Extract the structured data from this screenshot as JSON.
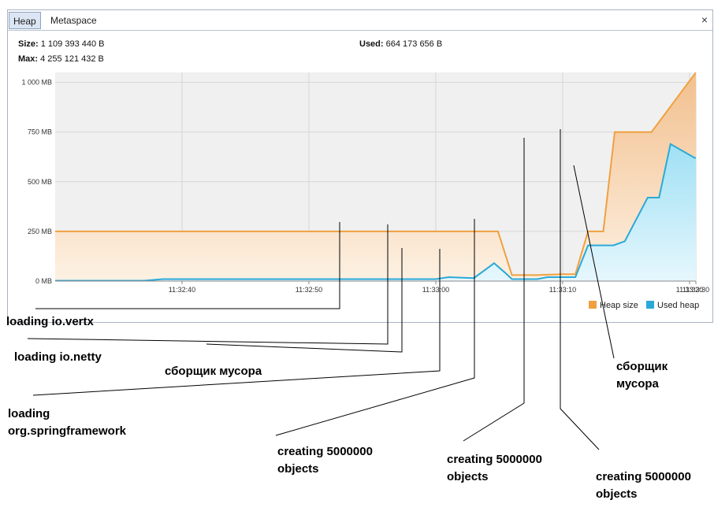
{
  "tabs": [
    {
      "label": "Heap"
    },
    {
      "label": "Metaspace"
    }
  ],
  "close_glyph": "×",
  "info": {
    "size_label": "Size:",
    "size_value": "1 109 393 440 B",
    "max_label": "Max:",
    "max_value": "4 255 121 432 B",
    "used_label": "Used:",
    "used_value": "664 173 656 B"
  },
  "legend": [
    {
      "label": "Heap size",
      "color": "#f0a040"
    },
    {
      "label": "Used heap",
      "color": "#2aa9d8"
    }
  ],
  "annotations": [
    {
      "text": "loading io.vertx"
    },
    {
      "text": "loading io.netty"
    },
    {
      "text": "сборщик мусора"
    },
    {
      "lines": [
        "loading",
        "org.springframework"
      ]
    },
    {
      "lines": [
        "creating 5000000",
        "objects"
      ]
    },
    {
      "lines": [
        "creating 5000000",
        "objects"
      ]
    },
    {
      "lines": [
        "creating 5000000",
        "objects"
      ]
    },
    {
      "lines": [
        "сборщик",
        "мусора"
      ]
    }
  ],
  "chart_data": {
    "type": "area",
    "x_unit": "seconds after 11:32:30",
    "xlim": [
      30,
      80.5
    ],
    "ylim": [
      0,
      1050
    ],
    "y_ticks": [
      {
        "value": 0,
        "label": "0 MB"
      },
      {
        "value": 250,
        "label": "250 MB"
      },
      {
        "value": 500,
        "label": "500 MB"
      },
      {
        "value": 750,
        "label": "750 MB"
      },
      {
        "value": 1000,
        "label": "1 000 MB"
      }
    ],
    "x_ticks": [
      {
        "value": 40,
        "label": "11:32:40"
      },
      {
        "value": 50,
        "label": "11:32:50"
      },
      {
        "value": 60,
        "label": "11:33:00"
      },
      {
        "value": 70,
        "label": "11:33:10"
      },
      {
        "value": 80,
        "label": "11:33:20"
      },
      {
        "value": 90,
        "label": "11:33:30"
      }
    ],
    "grid": true,
    "series": [
      {
        "name": "Heap size",
        "color": "#f0a040",
        "x": [
          30,
          64.9,
          66,
          68,
          70,
          71,
          72,
          73.2,
          74.1,
          76.5,
          77,
          80.5,
          91.5
        ],
        "y": [
          250,
          250,
          30,
          30,
          35,
          35,
          250,
          250,
          750,
          750,
          750,
          1050,
          1050
        ]
      },
      {
        "name": "Used heap",
        "color": "#2aa9d8",
        "x": [
          30,
          37,
          38.5,
          60,
          61,
          63,
          64.6,
          65.5,
          66,
          68,
          68.8,
          71,
          72,
          74,
          74.9,
          76.7,
          76.7,
          77.6,
          78.5,
          80.4,
          91.5
        ],
        "y": [
          2,
          2,
          10,
          10,
          20,
          15,
          90,
          40,
          10,
          10,
          20,
          20,
          180,
          180,
          200,
          420,
          420,
          420,
          690,
          620,
          630
        ]
      }
    ]
  }
}
